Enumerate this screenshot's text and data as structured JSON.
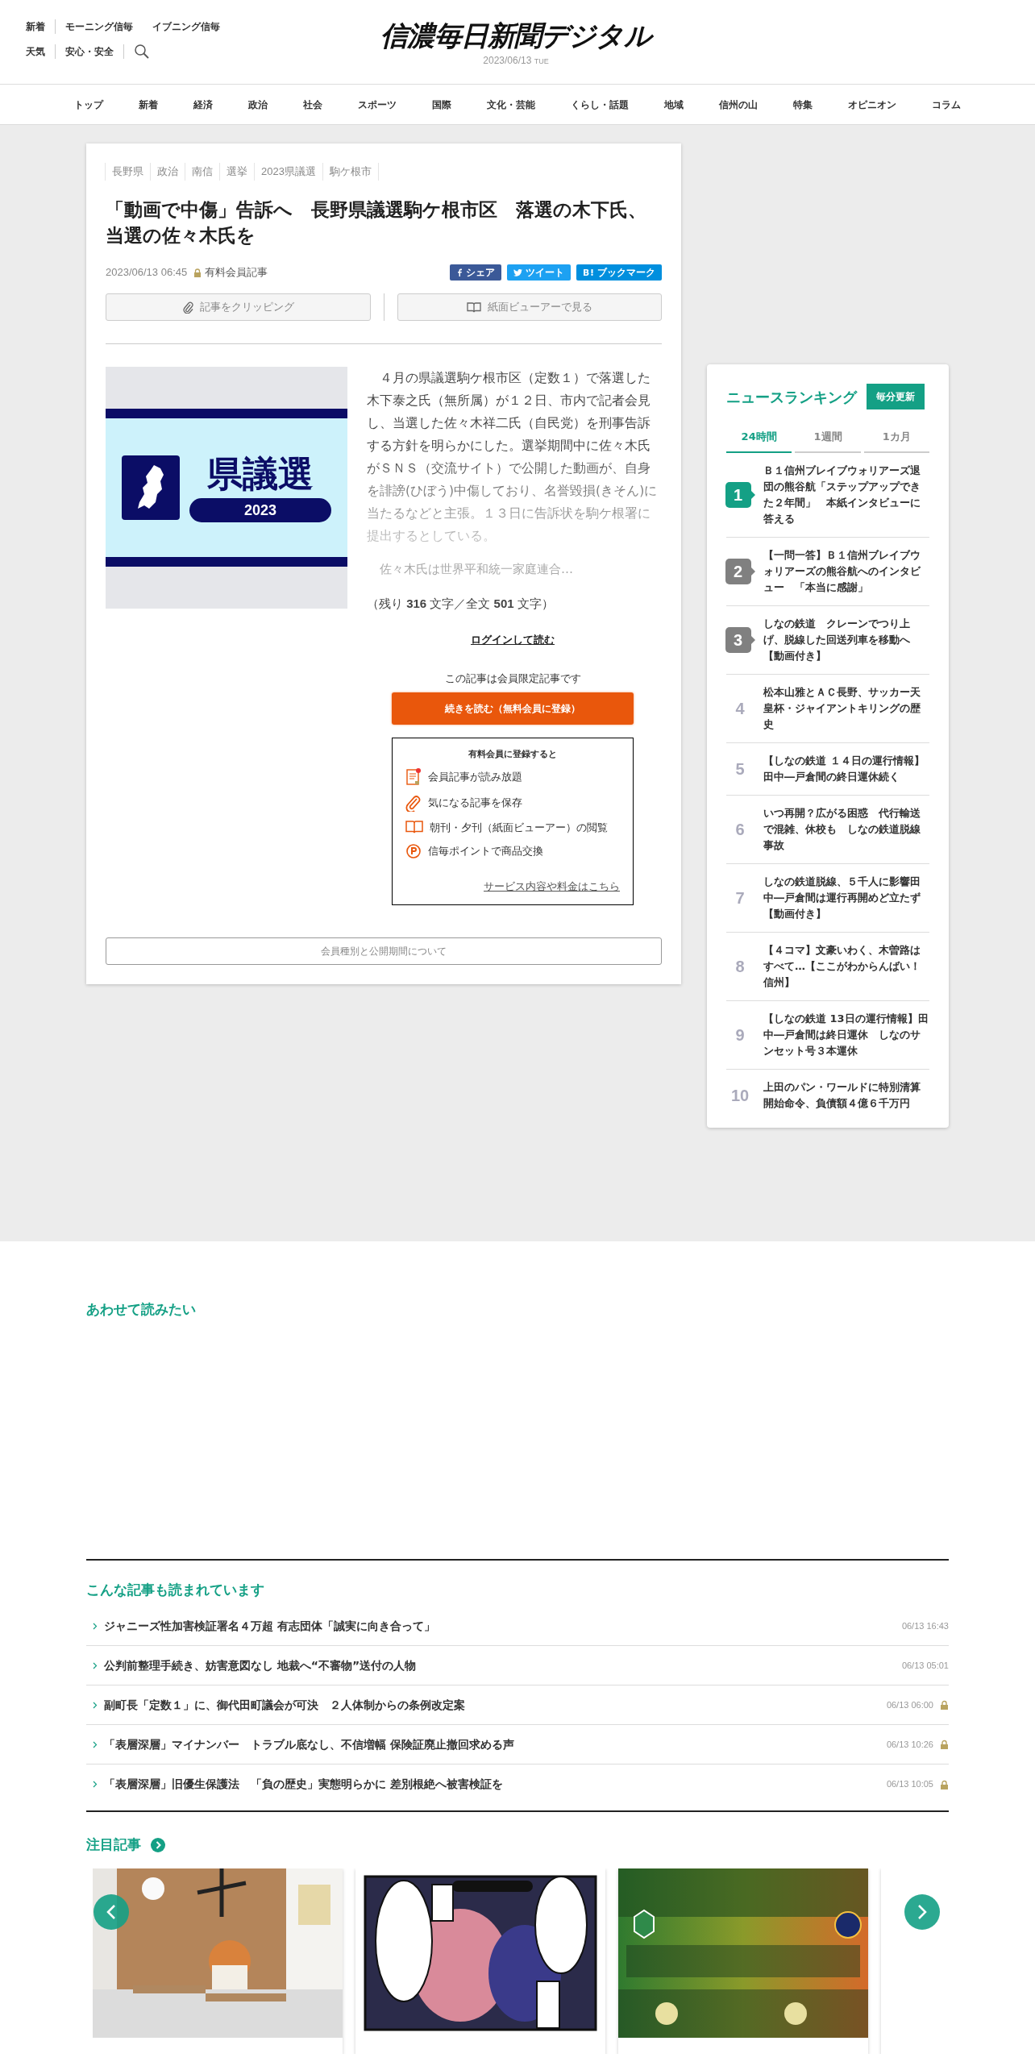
{
  "header": {
    "top_links": [
      "新着",
      "モーニング信毎",
      "イブニング信毎"
    ],
    "second_links": [
      "天気",
      "安心・安全"
    ],
    "logo": "信濃毎日新聞デジタル",
    "date": "2023/06/13",
    "weekday": "TUE"
  },
  "nav": [
    "トップ",
    "新着",
    "経済",
    "政治",
    "社会",
    "スポーツ",
    "国際",
    "文化・芸能",
    "くらし・話題",
    "地域",
    "信州の山",
    "特集",
    "オピニオン",
    "コラム"
  ],
  "article": {
    "tags": [
      "長野県",
      "政治",
      "南信",
      "選挙",
      "2023県議選",
      "駒ケ根市"
    ],
    "title": "「動画で中傷」告訴へ　長野県議選駒ケ根市区　落選の木下氏、当選の佐々木氏を",
    "datetime": "2023/06/13 06:45",
    "member_label": "有料会員記事",
    "share_buttons": [
      {
        "kind": "facebook",
        "label": "シェア"
      },
      {
        "kind": "twitter",
        "label": "ツイート"
      },
      {
        "kind": "hatena",
        "label": "ブックマーク"
      }
    ],
    "actions": [
      {
        "kind": "clip",
        "label": "記事をクリッピング"
      },
      {
        "kind": "viewer",
        "label": "紙面ビューアーで見る"
      }
    ],
    "image": {
      "banner_title": "県議選",
      "banner_year": "2023"
    },
    "body": "　４月の県議選駒ケ根市区（定数１）で落選した木下泰之氏（無所属）が１２日、市内で記者会見し、当選した佐々木祥二氏（自民党）を刑事告訴する方針を明らかにした。選挙期間中に佐々木氏がＳＮＳ（交流サイト）で公開した動画が、自身を誹謗(ひぼう)中傷しており、名誉毀損(きそん)に当たるなどと主張。１３日に告訴状を駒ケ根署に提出するとしている。",
    "teaser": "佐々木氏は世界平和統一家庭連合…",
    "remaining": "（残り **316** 文字／全文 **501** 文字）",
    "login_link": "ログインして読む",
    "member_only_note": "この記事は会員限定記事です",
    "read_more_button": "続きを読む（無料会員に登録）",
    "benefits": {
      "title": "有料会員に登録すると",
      "items": [
        {
          "kind": "doc",
          "label": "会員記事が読み放題"
        },
        {
          "kind": "clip",
          "label": "気になる記事を保存"
        },
        {
          "kind": "book",
          "label": "朝刊・夕刊（紙面ビューアー）の閲覧"
        },
        {
          "kind": "point",
          "label": "信毎ポイントで商品交換"
        }
      ],
      "link": "サービス内容や料金はこちら"
    },
    "membership_button": "会員種別と公開期間について"
  },
  "ranking": {
    "title": "ニュースランキング",
    "update_badge": "毎分更新",
    "tabs": [
      {
        "label": "24時間",
        "selected": true
      },
      {
        "label": "1週間",
        "selected": false
      },
      {
        "label": "1カ月",
        "selected": false
      }
    ],
    "items": [
      {
        "rank": "1",
        "kind": "badge",
        "color": "#14a085",
        "title": "Ｂ１信州ブレイブウォリアーズ退団の熊谷航「ステップアップできた２年間」　本紙インタビューに答える"
      },
      {
        "rank": "2",
        "kind": "badge",
        "color": "#808080",
        "title": "【一問一答】Ｂ１信州ブレイブウォリアーズの熊谷航へのインタビュー　「本当に感謝」"
      },
      {
        "rank": "3",
        "kind": "badge",
        "color": "#808080",
        "title": "しなの鉄道　クレーンでつり上げ、脱線した回送列車を移動へ【動画付き】"
      },
      {
        "rank": "4",
        "kind": "plain",
        "title": "松本山雅とＡＣ長野、サッカー天皇杯・ジャイアントキリングの歴史"
      },
      {
        "rank": "5",
        "kind": "plain",
        "title": "【しなの鉄道 １４日の運行情報】田中―戸倉間の終日運休続く"
      },
      {
        "rank": "6",
        "kind": "plain",
        "title": "いつ再開？広がる困惑　代行輸送で混雑、休校も　しなの鉄道脱線事故"
      },
      {
        "rank": "7",
        "kind": "plain",
        "title": "しなの鉄道脱線、５千人に影響田中―戸倉間は運行再開めど立たず【動画付き】"
      },
      {
        "rank": "8",
        "kind": "plain",
        "title": "【４コマ】文豪いわく、木曽路はすべて…【ここがわからんばい！信州】"
      },
      {
        "rank": "9",
        "kind": "plain",
        "title": "【しなの鉄道 13日の運行情報】田中―戸倉間は終日運休　しなのサンセット号３本運休"
      },
      {
        "rank": "10",
        "kind": "plain",
        "title": "上田のパン・ワールドに特別清算開始命令、負債額４億６千万円"
      }
    ]
  },
  "related": {
    "title": "あわせて読みたい"
  },
  "popular": {
    "title": "こんな記事も読まれています",
    "items": [
      {
        "title": "ジャニーズ性加害検証署名４万超 有志団体「誠実に向き合って」",
        "time": "06/13 16:43",
        "locked": false
      },
      {
        "title": "公判前整理手続き、妨害意図なし 地裁へ“不審物”送付の人物",
        "time": "06/13 05:01",
        "locked": false
      },
      {
        "title": "副町長「定数１」に、御代田町議会が可決　２人体制からの条例改定案",
        "time": "06/13 06:00",
        "locked": true
      },
      {
        "title": "「表層深層」マイナンバー　トラブル底なし、不信増幅 保険証廃止撤回求める声",
        "time": "06/13 10:26",
        "locked": true
      },
      {
        "title": "「表層深層」旧優生保護法　「負の歴史」実態明らかに 差別根絶へ被害検証を",
        "time": "06/13 10:05",
        "locked": true
      }
    ]
  },
  "featured": {
    "title": "注目記事",
    "cards": [
      {
        "kind": "cat"
      },
      {
        "kind": "manga"
      },
      {
        "kind": "poster"
      },
      {
        "kind": "blank"
      }
    ]
  }
}
